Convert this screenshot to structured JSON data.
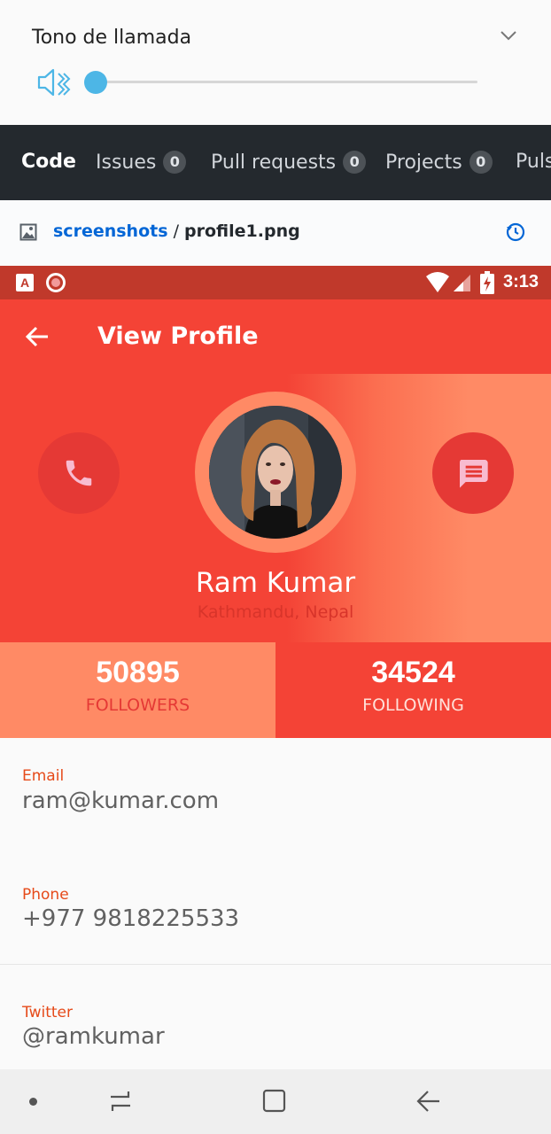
{
  "volume_panel": {
    "title": "Tono de llamada",
    "icons": {
      "mute": "speaker-muted-icon",
      "expand": "chevron-down-icon"
    },
    "level": 0,
    "accent": "#4db6e6"
  },
  "github_nav": {
    "tabs": [
      {
        "label": "Code",
        "count": null
      },
      {
        "label": "Issues",
        "count": "0"
      },
      {
        "label": "Pull requests",
        "count": "0"
      },
      {
        "label": "Projects",
        "count": "0"
      },
      {
        "label": "Puls",
        "count": null
      }
    ]
  },
  "breadcrumb": {
    "folder": "screenshots",
    "separator": "/",
    "file": "profile1.png",
    "icons": {
      "file": "image-file-icon",
      "history": "history-icon"
    }
  },
  "status_bar": {
    "time": "3:13",
    "badge_letter": "A",
    "icons": [
      "a-notification-icon",
      "record-icon",
      "wifi-icon",
      "signal-icon",
      "battery-charging-icon"
    ]
  },
  "app_bar": {
    "title": "View Profile",
    "back_icon": "arrow-back-icon"
  },
  "profile": {
    "name": "Ram Kumar",
    "location": "Kathmandu, Nepal",
    "call_icon": "phone-icon",
    "message_icon": "message-icon",
    "avatar": "avatar-photo"
  },
  "stats": {
    "followers": {
      "value": "50895",
      "label": "FOLLOWERS"
    },
    "following": {
      "value": "34524",
      "label": "FOLLOWING"
    }
  },
  "info": {
    "email": {
      "label": "Email",
      "value": "ram@kumar.com"
    },
    "phone": {
      "label": "Phone",
      "value": "+977 9818225533"
    },
    "twitter": {
      "label": "Twitter",
      "value": "@ramkumar"
    }
  },
  "colors": {
    "primary": "#f44336",
    "primary_dark": "#c0392b",
    "accent": "#ff8a65",
    "label": "#e64a19",
    "github_dark": "#24292e",
    "link": "#0366d6"
  },
  "nav_bar": {
    "icons": [
      "dot-icon",
      "recents-icon",
      "home-icon",
      "back-icon"
    ]
  }
}
